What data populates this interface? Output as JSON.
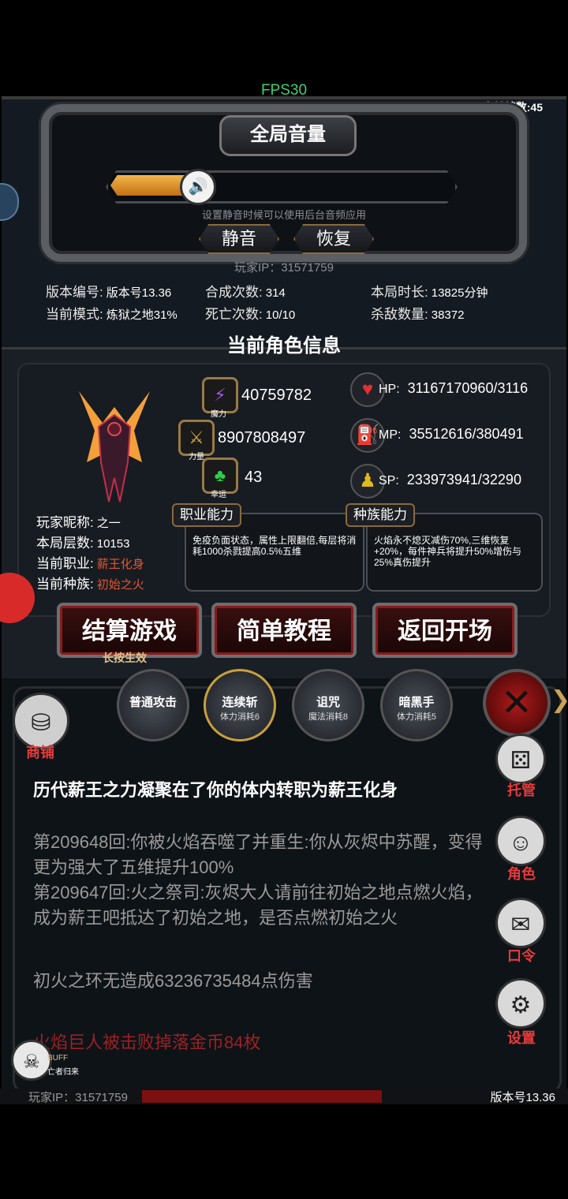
{
  "hud": {
    "fps": "FPS30",
    "frame_count": "当前帧数:45"
  },
  "volume": {
    "title": "全局音量",
    "level_percent": 25,
    "hint": "设置静音时候可以使用后台音频应用",
    "mute_label": "静音",
    "restore_label": "恢复",
    "player_ip": "玩家IP：31571759"
  },
  "stats": {
    "version_label": "版本编号:",
    "version_value": "版本号13.36",
    "mode_label": "当前模式:",
    "mode_value": "炼狱之地31%",
    "synth_label": "合成次数:",
    "synth_value": "314",
    "death_label": "死亡次数:",
    "death_value": "10/10",
    "duration_label": "本局时长:",
    "duration_value": "13825分钟",
    "kills_label": "杀敌数量:",
    "kills_value": "38372"
  },
  "character": {
    "section_title": "当前角色信息",
    "magic_label": "魔力",
    "magic_value": "40759782",
    "strength_label": "力量",
    "strength_value": "8907808497",
    "luck_label": "幸运",
    "luck_value": "43",
    "hp_label": "HP:",
    "hp_value": "3116717096​0/3116",
    "mp_label": "MP:",
    "mp_value": "35512616/380491",
    "sp_label": "SP:",
    "sp_value": "233973941/32290",
    "nickname_label": "玩家昵称:",
    "nickname_value": "之一",
    "floor_label": "本局层数:",
    "floor_value": "10153",
    "job_label": "当前职业:",
    "job_value": "薪王化身",
    "race_label": "当前种族:",
    "race_value": "初始之火",
    "job_ability_title": "职业能力",
    "job_ability_text": "免疫负面状态，属性上限翻倍,每层将消耗1000杀戮提高0.5%五维",
    "race_ability_title": "种族能力",
    "race_ability_text": "火焰永不熄灭减伤70%,三维恢复+20%，每件神兵将提升50%增伤与25%真伤提升"
  },
  "actions": {
    "settle_label": "结算游戏",
    "settle_hint": "长按生效",
    "tutorial_label": "简单教程",
    "back_label": "返回开场"
  },
  "skills": [
    {
      "name": "普通攻击",
      "cost": ""
    },
    {
      "name": "连续斩",
      "cost": "体力消耗6"
    },
    {
      "name": "诅咒",
      "cost": "魔法消耗8"
    },
    {
      "name": "暗黑手",
      "cost": "体力消耗5"
    }
  ],
  "side_menu": {
    "shop": "商铺",
    "auto": "托管",
    "role": "角色",
    "code": "口令",
    "settings": "设置"
  },
  "log": {
    "line1": "历代薪王之力凝聚在了你的体内转职为薪王化身",
    "line2": "第209648回:你被火焰吞噬了并重生:你从灰烬中苏醒，变得更为强大了五维提升100%",
    "line3": "第209647回:火之祭司:灰烬大人请前往初始之地点燃火焰，成为薪王吧抵达了初始之地，是否点燃初始之火",
    "line4": "初火之环无造成63236735484点伤害",
    "line5": "火焰巨人被击败掉落金币84枚"
  },
  "buff": {
    "title": "BUFF",
    "name": "亡者归来"
  },
  "footer": {
    "player_ip": "玩家IP：31571759",
    "version": "版本号13.36"
  }
}
